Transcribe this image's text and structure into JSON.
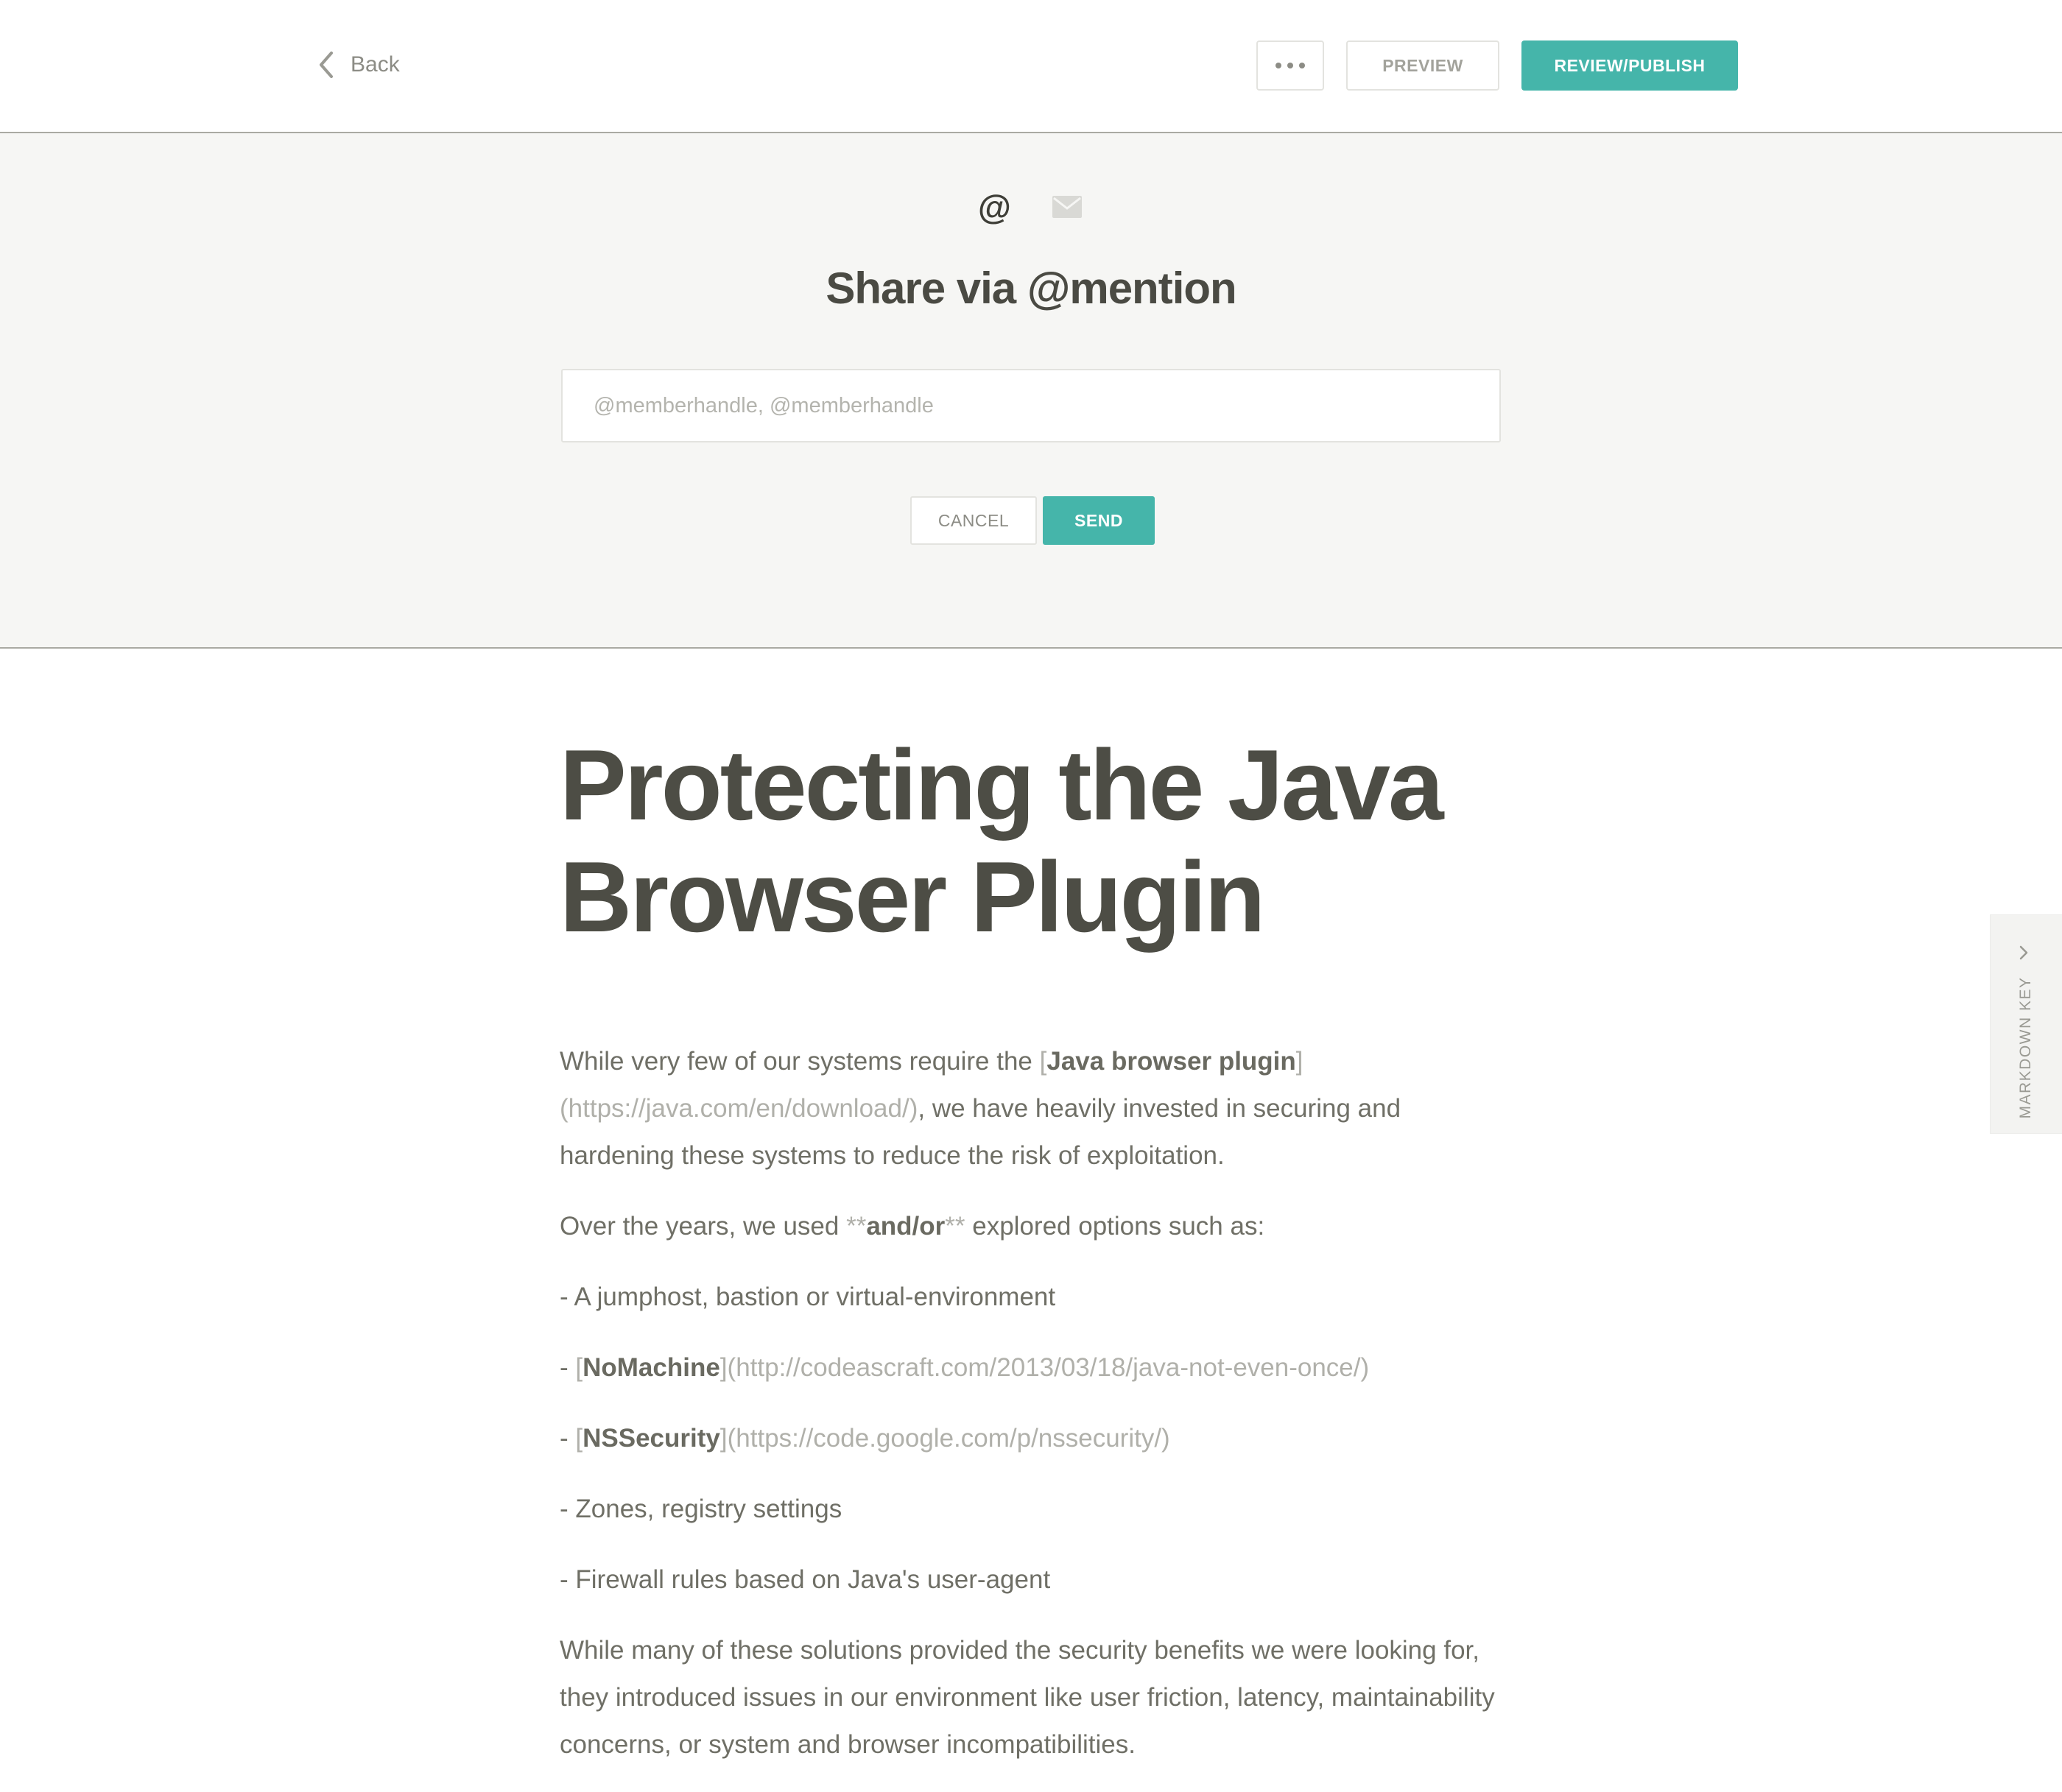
{
  "header": {
    "back_label": "Back",
    "preview_label": "PREVIEW",
    "publish_label": "REVIEW/PUBLISH"
  },
  "share": {
    "at_symbol": "@",
    "title": "Share via @mention",
    "input_placeholder": "@memberhandle, @memberhandle",
    "input_value": "",
    "cancel_label": "CANCEL",
    "send_label": "SEND"
  },
  "document": {
    "title": "Protecting the Java Browser Plugin",
    "p1": {
      "t1": "While very few of our systems require the ",
      "b_open": "[",
      "bold": "Java browser plugin",
      "link": "](https://java.com/en/download/)",
      "t2": ", we have heavily invested in securing and hardening these systems to reduce the risk of exploitation."
    },
    "p2": {
      "t1": "Over the years, we used ",
      "m1": "**",
      "bold": "and/or",
      "m2": "**",
      "t2": " explored options such as:"
    },
    "items": {
      "i1": "- A jumphost, bastion or virtual-environment",
      "i2": {
        "prefix": "- ",
        "b_open": "[",
        "bold": "NoMachine",
        "link": "](http://codeascraft.com/2013/03/18/java-not-even-once/)"
      },
      "i3": {
        "prefix": "- ",
        "b_open": "[",
        "bold": "NSSecurity",
        "link": "](https://code.google.com/p/nssecurity/)"
      },
      "i4": "- Zones, registry settings",
      "i5": "- Firewall rules based on Java's user-agent"
    },
    "p3": "While many of these solutions provided the security benefits we were looking for, they introduced issues in our environment like user friction, latency, maintainability concerns, or system and browser incompatibilities."
  },
  "markdown_key": {
    "label": "MARKDOWN KEY"
  },
  "icons": {
    "back": "chevron-left-icon",
    "more": "more-dots-icon",
    "mention": "at-icon",
    "email": "mail-icon",
    "markdown_key": "chevron-right-icon"
  },
  "colors": {
    "accent": "#45b5aa",
    "panel_background": "#f6f6f4",
    "title_text": "#4d4d45",
    "body_text": "#6f6f66",
    "markdown_syntax": "#b0b0aa"
  }
}
